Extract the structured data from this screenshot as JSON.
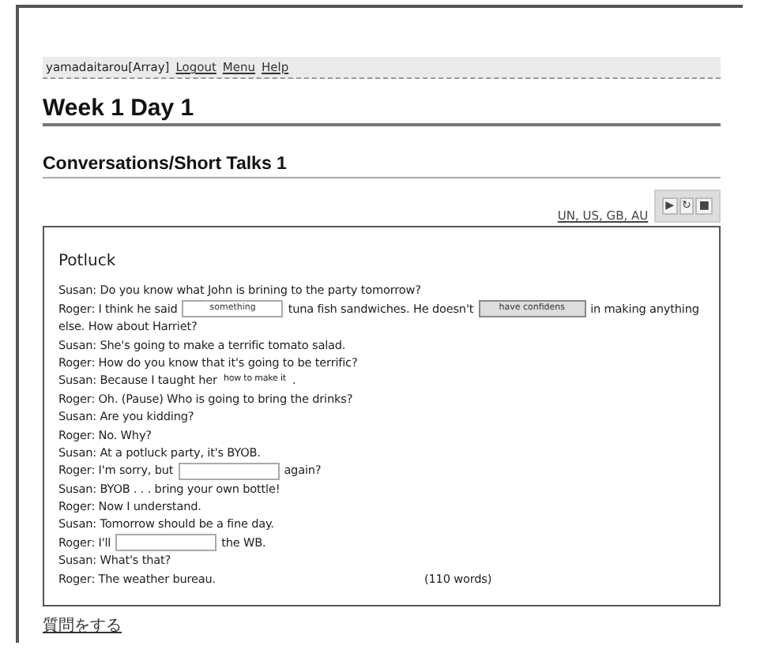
{
  "nav": {
    "user": "yamadaitarou[Array]",
    "links": [
      "Logout",
      "Menu",
      "Help"
    ]
  },
  "title": "Week 1 Day 1",
  "subtitle": "Conversations/Short Talks 1",
  "accents": "UN, US, GB, AU",
  "player": {
    "buttons": [
      "▶",
      "↻",
      "■"
    ]
  },
  "passage": {
    "heading": "Potluck",
    "lines": [
      [
        {
          "kind": "text",
          "text": "Susan: Do you know what John is brining to the party tomorrow?"
        }
      ],
      [
        {
          "kind": "text",
          "text": "Roger: I think he said"
        },
        {
          "kind": "field",
          "value": "something",
          "highlighted": false
        },
        {
          "kind": "text",
          "text": "tuna fish sandwiches. He doesn't"
        },
        {
          "kind": "field",
          "value": "have confidens",
          "highlighted": true
        },
        {
          "kind": "text",
          "text": "in making anything"
        }
      ],
      [
        {
          "kind": "text",
          "text": "else. How about Harriet?"
        }
      ],
      [
        {
          "kind": "text",
          "text": "Susan: She's going to make a terrific tomato salad."
        }
      ],
      [
        {
          "kind": "text",
          "text": "Roger: How do you know that it's going to be terrific?"
        }
      ],
      [
        {
          "kind": "text",
          "text": "Susan: Because I taught her"
        },
        {
          "kind": "answer",
          "value": "how to make it"
        },
        {
          "kind": "text",
          "text": "."
        }
      ],
      [
        {
          "kind": "text",
          "text": "Roger: Oh. (Pause) Who is going to bring the drinks?"
        }
      ],
      [
        {
          "kind": "text",
          "text": "Susan: Are you kidding?"
        }
      ],
      [
        {
          "kind": "text",
          "text": "Roger: No. Why?"
        }
      ],
      [
        {
          "kind": "text",
          "text": "Susan: At a potluck party, it's BYOB."
        }
      ],
      [
        {
          "kind": "text",
          "text": "Roger: I'm sorry, but"
        },
        {
          "kind": "field",
          "highlighted": false
        },
        {
          "kind": "text",
          "text": "again?"
        }
      ],
      [
        {
          "kind": "text",
          "text": "Susan: BYOB . . . bring your own bottle!"
        }
      ],
      [
        {
          "kind": "text",
          "text": "Roger: Now I understand."
        }
      ],
      [
        {
          "kind": "text",
          "text": "Susan: Tomorrow should be a fine day."
        }
      ],
      [
        {
          "kind": "text",
          "text": "Roger: I'll"
        },
        {
          "kind": "field",
          "highlighted": false
        },
        {
          "kind": "text",
          "text": "the WB."
        }
      ],
      [
        {
          "kind": "text",
          "text": "Susan: What's that?"
        }
      ],
      [
        {
          "kind": "text",
          "text": "Roger: The weather bureau."
        },
        {
          "kind": "note",
          "text": "(110 words)"
        }
      ]
    ]
  },
  "question_link": "質問をする"
}
